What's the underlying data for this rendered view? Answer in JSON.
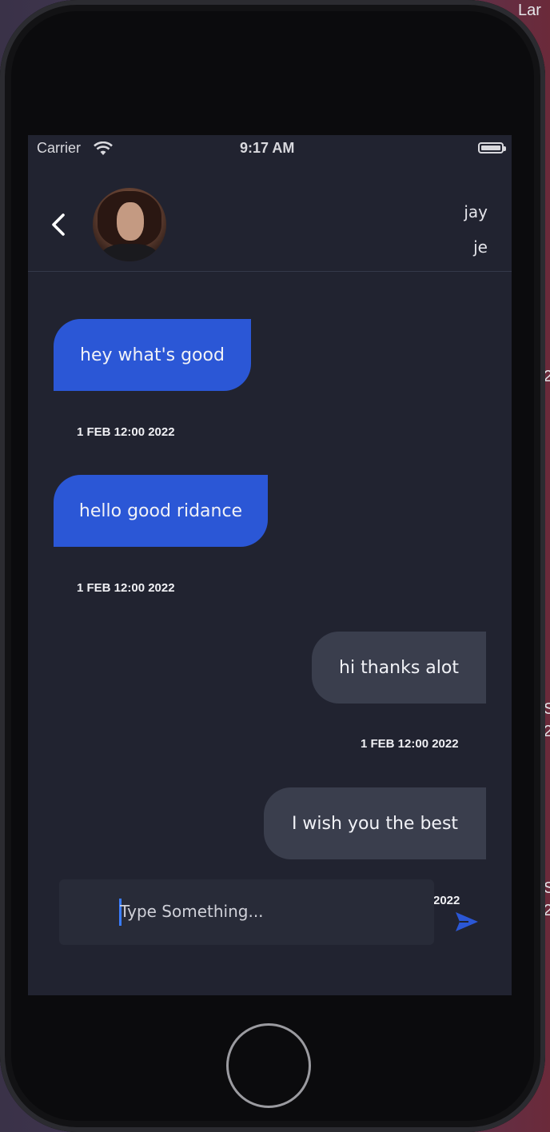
{
  "background_fragments": [
    "Lar",
    "2",
    "S",
    "2",
    "S",
    "2"
  ],
  "status_bar": {
    "carrier": "Carrier",
    "time": "9:17 AM"
  },
  "header": {
    "contact_name_line1": "jay",
    "contact_name_line2": "je"
  },
  "messages": [
    {
      "direction": "received",
      "text": "hey what's good",
      "timestamp": "1 FEB 12:00 2022"
    },
    {
      "direction": "received",
      "text": "hello good ridance",
      "timestamp": "1 FEB 12:00 2022"
    },
    {
      "direction": "sent",
      "text": "hi thanks alot",
      "timestamp": "1 FEB 12:00 2022"
    },
    {
      "direction": "sent",
      "text": "I wish you the best",
      "timestamp_partial": "2022"
    }
  ],
  "composer": {
    "placeholder": "Type Something...",
    "value": ""
  },
  "colors": {
    "screen_bg": "#212330",
    "received_bubble": "#2b57d6",
    "sent_bubble": "#3a3e4d",
    "send_icon": "#2b57d6",
    "caret": "#3a7cff"
  },
  "icons": {
    "back": "chevron-left-icon",
    "send": "send-arrow-icon",
    "wifi": "wifi-icon",
    "battery": "battery-icon"
  }
}
